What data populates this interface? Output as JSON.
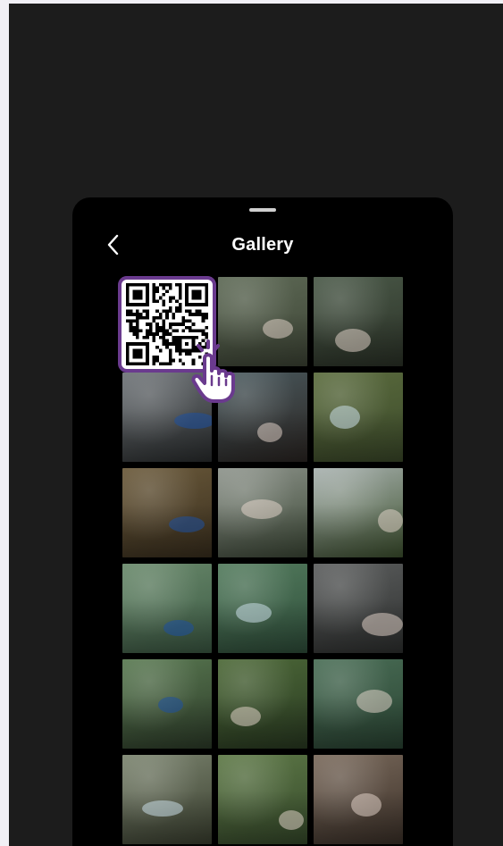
{
  "header": {
    "title": "Gallery",
    "back_icon": "chevron-left-icon"
  },
  "colors": {
    "page_bg": "#f1f0f5",
    "stage_bg": "#1c1c1c",
    "sheet_bg": "#000000",
    "qr_frame": "#6a3a8e",
    "handle": "#cfcfcf"
  },
  "qr_icon": "qr-code-icon",
  "pointer_icon": "hand-pointer-icon",
  "gallery": {
    "tiles": [
      {
        "name": "qr-code",
        "colors": [
          "#ffffff",
          "#ffffff"
        ]
      },
      {
        "name": "photo-duck-rocks",
        "colors": [
          "#5f6b57",
          "#3e4536"
        ]
      },
      {
        "name": "photo-peacock-stream",
        "colors": [
          "#4b5a49",
          "#2c3328"
        ]
      },
      {
        "name": "photo-egret-perch",
        "colors": [
          "#6f7478",
          "#2b2e2f"
        ]
      },
      {
        "name": "photo-crowned-pigeon",
        "colors": [
          "#4a5a5f",
          "#2c2623"
        ]
      },
      {
        "name": "photo-peacock-grass",
        "colors": [
          "#5c6d3f",
          "#3c4a2a"
        ]
      },
      {
        "name": "photo-tree-trunk",
        "colors": [
          "#6b5a3b",
          "#3a2f1e"
        ]
      },
      {
        "name": "photo-stork",
        "colors": [
          "#8f958d",
          "#3e4a38"
        ]
      },
      {
        "name": "photo-aviary-bird",
        "colors": [
          "#a9b2b0",
          "#3f5330"
        ]
      },
      {
        "name": "photo-flamingos-water",
        "colors": [
          "#6a8a6c",
          "#3c5a44"
        ]
      },
      {
        "name": "photo-flamingos-pond",
        "colors": [
          "#557d5f",
          "#2f4f3b"
        ]
      },
      {
        "name": "photo-flamingo-group",
        "colors": [
          "#5d5f5f",
          "#2f3130"
        ]
      },
      {
        "name": "photo-peacock-display",
        "colors": [
          "#5a7a52",
          "#2e3d2a"
        ]
      },
      {
        "name": "photo-bird-branch",
        "colors": [
          "#4e6a39",
          "#2a3b22"
        ]
      },
      {
        "name": "photo-birds-lake",
        "colors": [
          "#4b6f57",
          "#2a4433"
        ]
      },
      {
        "name": "photo-egret-closeup",
        "colors": [
          "#7c8570",
          "#3b4030"
        ]
      },
      {
        "name": "photo-peacock-lawn",
        "colors": [
          "#5f7a48",
          "#364a2b"
        ]
      },
      {
        "name": "photo-peahen-pavement",
        "colors": [
          "#7a6a5c",
          "#3c3129"
        ]
      }
    ]
  }
}
